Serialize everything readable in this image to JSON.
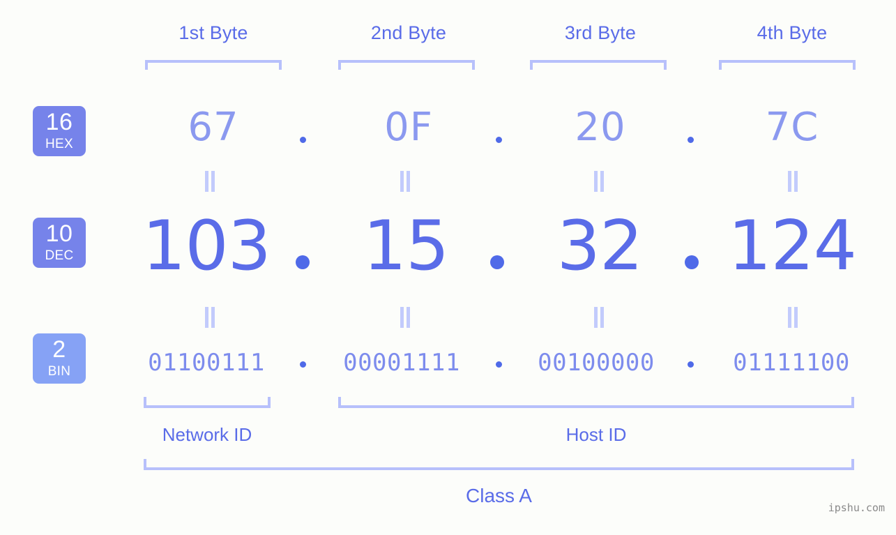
{
  "bytes": {
    "headers": [
      "1st Byte",
      "2nd Byte",
      "3rd Byte",
      "4th Byte"
    ]
  },
  "bases": [
    {
      "number": "16",
      "name": "HEX",
      "color": "#7683ea"
    },
    {
      "number": "10",
      "name": "DEC",
      "color": "#7683ea"
    },
    {
      "number": "2",
      "name": "BIN",
      "color": "#86a2f5"
    }
  ],
  "rows": {
    "hex": [
      "67",
      "0F",
      "20",
      "7C"
    ],
    "dec": [
      "103",
      "15",
      "32",
      "124"
    ],
    "bin": [
      "01100111",
      "00001111",
      "00100000",
      "01111100"
    ]
  },
  "separator": ".",
  "equals_glyph": "=",
  "segments": {
    "network_id": "Network ID",
    "host_id": "Host ID"
  },
  "class_label": "Class A",
  "watermark": "ipshu.com",
  "colors": {
    "background": "#fcfdfa",
    "accent": "#5a6ce8",
    "bracket": "#b7c0fb",
    "hex_text": "#8b99ef",
    "dec_text": "#5a6ce8",
    "bin_text": "#7d8ced",
    "dot": "#4f6ae8",
    "equals": "#c2cbfc",
    "badge_text": "#ffffff",
    "watermark": "#8a8a8a"
  }
}
